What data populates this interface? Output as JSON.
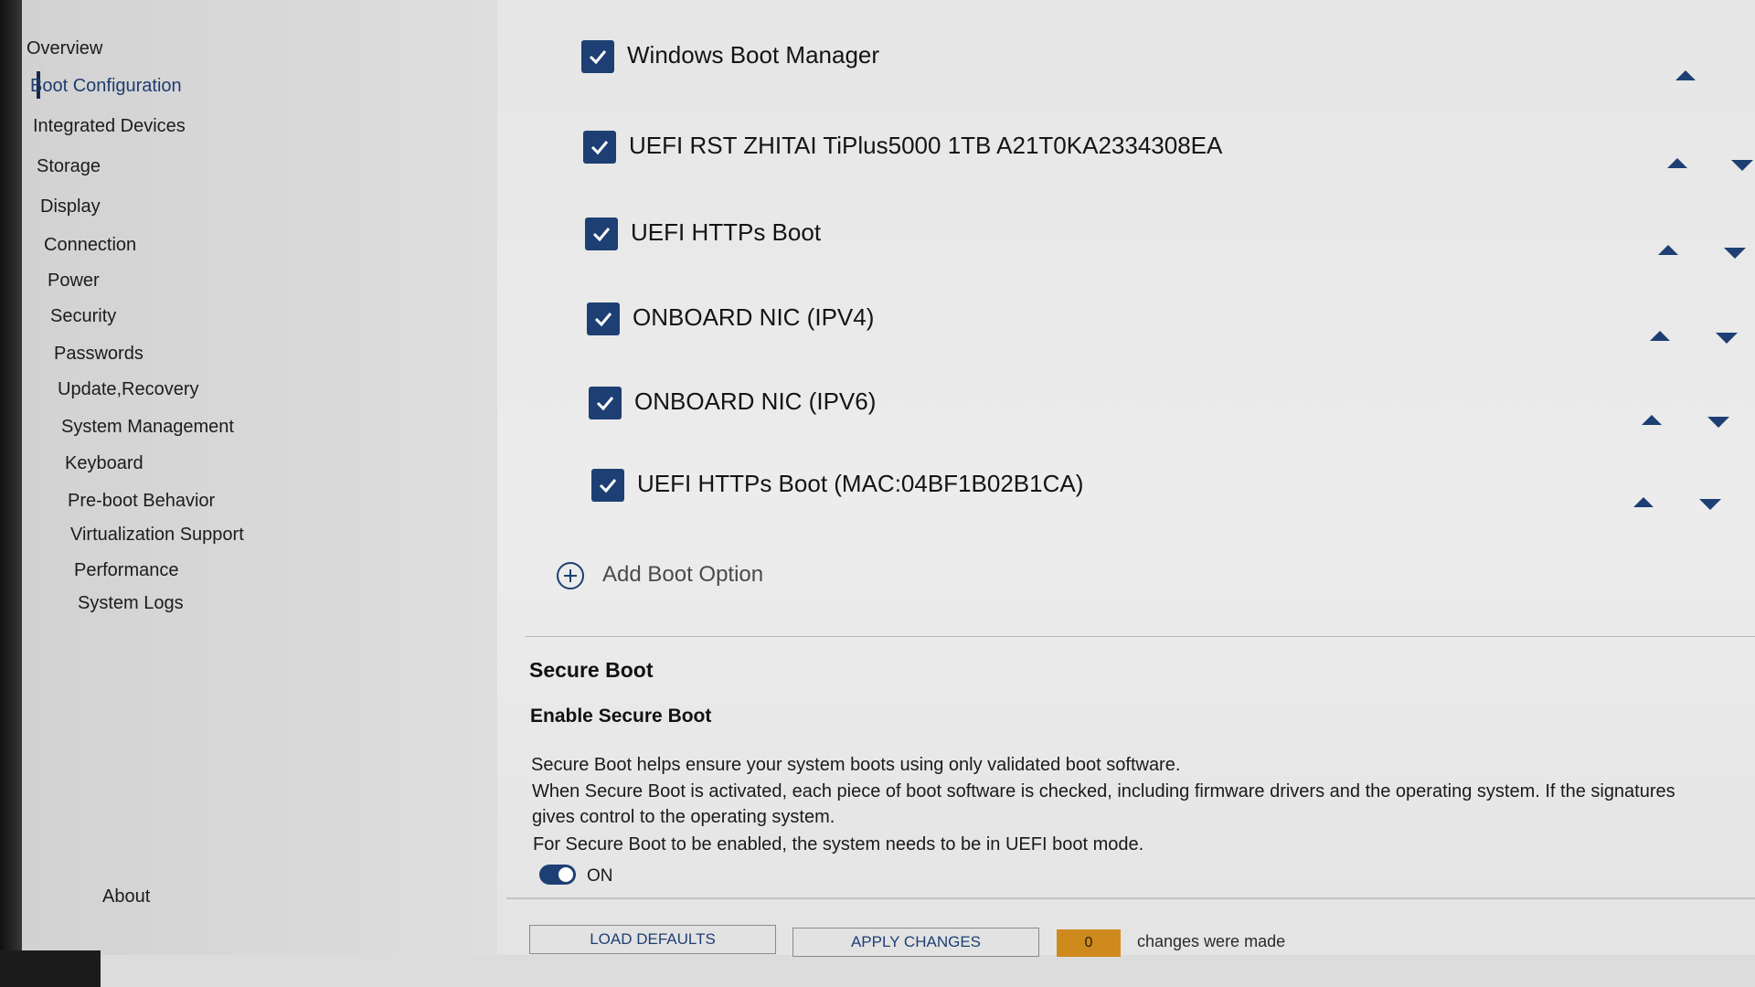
{
  "sidebar": {
    "items": [
      {
        "label": "Overview"
      },
      {
        "label": "Boot Configuration"
      },
      {
        "label": "Integrated Devices"
      },
      {
        "label": "Storage"
      },
      {
        "label": "Display"
      },
      {
        "label": "Connection"
      },
      {
        "label": "Power"
      },
      {
        "label": "Security"
      },
      {
        "label": "Passwords"
      },
      {
        "label": "Update,Recovery"
      },
      {
        "label": "System Management"
      },
      {
        "label": "Keyboard"
      },
      {
        "label": "Pre-boot Behavior"
      },
      {
        "label": "Virtualization Support"
      },
      {
        "label": "Performance"
      },
      {
        "label": "System Logs"
      }
    ],
    "active_item": "Boot Configuration",
    "about_label": "About"
  },
  "boot_sequence": {
    "items": [
      {
        "label": "Windows Boot Manager",
        "checked": true
      },
      {
        "label": "UEFI RST ZHITAI TiPlus5000 1TB A21T0KA2334308EA",
        "checked": true
      },
      {
        "label": "UEFI HTTPs Boot",
        "checked": true
      },
      {
        "label": "ONBOARD NIC (IPV4)",
        "checked": true
      },
      {
        "label": "ONBOARD NIC (IPV6)",
        "checked": true
      },
      {
        "label": "UEFI HTTPs Boot (MAC:04BF1B02B1CA)",
        "checked": true
      }
    ],
    "add_option_label": "Add Boot Option"
  },
  "secure_boot": {
    "section_title": "Secure Boot",
    "setting_title": "Enable Secure Boot",
    "description": [
      "Secure Boot helps ensure your system boots using only validated boot software.",
      "When Secure Boot is activated, each piece of boot software is checked, including firmware drivers and the operating system. If the signatures",
      "gives control to the operating system.",
      "For Secure Boot to be enabled, the system needs to be in UEFI boot mode."
    ],
    "toggle_state": "ON"
  },
  "footer": {
    "load_defaults_label": "LOAD DEFAULTS",
    "apply_changes_label": "APPLY CHANGES",
    "changes_count": "0",
    "changes_text": "changes were made"
  },
  "colors": {
    "accent": "#1d3f73",
    "badge": "#cf8a1d",
    "background": "#e6e6e6"
  }
}
